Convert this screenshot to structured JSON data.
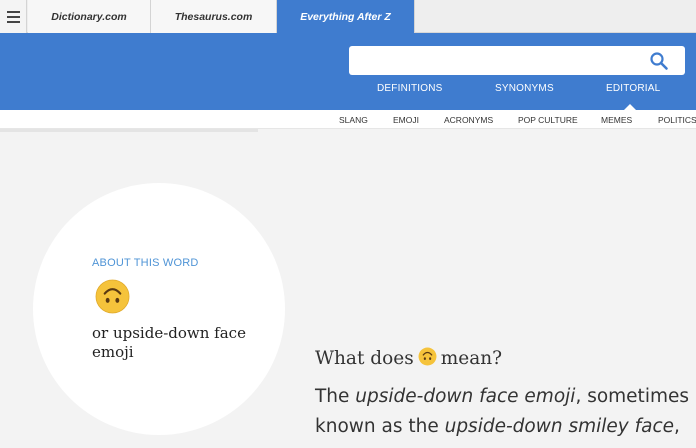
{
  "tabs": [
    {
      "label": "Dictionary.com"
    },
    {
      "label": "Thesaurus.com"
    },
    {
      "label": "Everything After Z"
    }
  ],
  "menu_icon": "hamburger-menu-icon",
  "search": {
    "value": "",
    "placeholder": "",
    "icon": "search-icon"
  },
  "nav": [
    {
      "label": "DEFINITIONS"
    },
    {
      "label": "SYNONYMS"
    },
    {
      "label": "EDITORIAL"
    }
  ],
  "subnav": [
    {
      "label": "SLANG"
    },
    {
      "label": "EMOJI"
    },
    {
      "label": "ACRONYMS"
    },
    {
      "label": "POP CULTURE"
    },
    {
      "label": "MEMES"
    },
    {
      "label": "POLITICS"
    }
  ],
  "about": {
    "heading": "ABOUT THIS WORD",
    "emoji_icon": "upside-down-face-emoji-icon",
    "alt_name": "or upside-down face emoji"
  },
  "article": {
    "question_prefix": "What does",
    "question_suffix": "mean?",
    "para_1": "The ",
    "para_2": "upside-down face emoji",
    "para_3": ", sometimes known as the ",
    "para_4": "upside-down smiley face",
    "para_5": ","
  },
  "colors": {
    "brand_blue": "#3f7ccf",
    "accent_text_blue": "#4f94d6",
    "emoji_yellow": "#f5c33b"
  }
}
